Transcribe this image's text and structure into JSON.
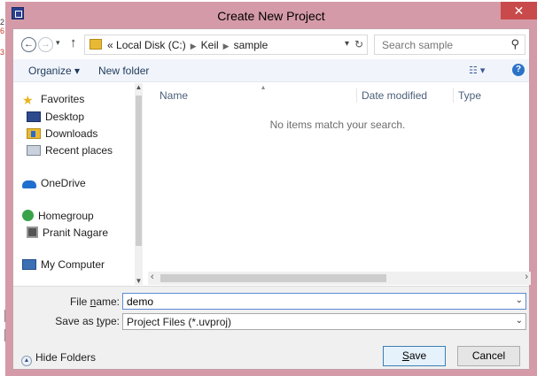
{
  "window": {
    "title": "Create New Project",
    "close_glyph": "✕",
    "app_icon": "keil-uvision-icon"
  },
  "background_edge": [
    "2",
    "6",
    "3"
  ],
  "address_bar": {
    "overflow": "«",
    "path": [
      "Local Disk (C:)",
      "Keil",
      "sample"
    ],
    "search_placeholder": "Search sample"
  },
  "toolbar": {
    "organize": "Organize ▾",
    "new_folder": "New folder",
    "view": "☷ ▾",
    "help": "?"
  },
  "nav_pane": {
    "items": [
      {
        "label": "Favorites",
        "icon": "star-icon"
      },
      {
        "label": "Desktop",
        "icon": "desktop-icon"
      },
      {
        "label": "Downloads",
        "icon": "downloads-icon"
      },
      {
        "label": "Recent places",
        "icon": "recent-places-icon"
      },
      {
        "label": "OneDrive",
        "icon": "cloud-icon"
      },
      {
        "label": "Homegroup",
        "icon": "homegroup-icon"
      },
      {
        "label": "Pranit Nagare",
        "icon": "user-icon"
      },
      {
        "label": "My Computer",
        "icon": "computer-icon"
      }
    ]
  },
  "file_list": {
    "columns": [
      "Name",
      "Date modified",
      "Type"
    ],
    "empty_message": "No items match your search."
  },
  "form": {
    "file_name_label_pre": "File ",
    "file_name_label_u": "n",
    "file_name_label_post": "ame:",
    "file_name_value": "demo",
    "save_type_label_pre": "Save as ",
    "save_type_label_u": "t",
    "save_type_label_post": "ype:",
    "save_type_value": "Project Files (*.uvproj)",
    "hide_folders": "Hide Folders",
    "save_u": "S",
    "save_rest": "ave",
    "cancel": "Cancel"
  },
  "colors": {
    "titlebar": "#d59aa8",
    "close_button": "#c94a4a",
    "toolbar": "#f1f5fb",
    "form_area": "#f0f0f0"
  }
}
